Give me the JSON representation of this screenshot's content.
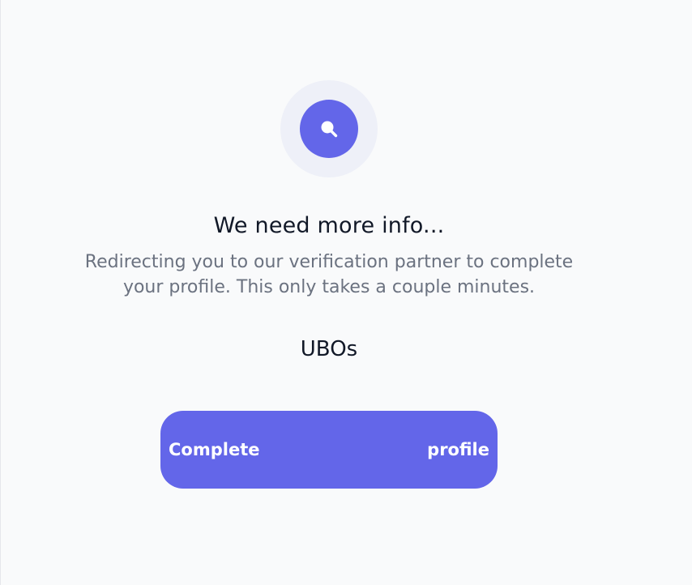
{
  "header": {
    "icon": "search-icon",
    "title": "We need more info..."
  },
  "message": {
    "line1": "Redirecting you to our verification partner to complete",
    "line2": "your profile. This only takes a couple minutes."
  },
  "section": {
    "label": "UBOs"
  },
  "actions": {
    "complete_word_1": "Complete",
    "complete_word_2": "profile"
  },
  "colors": {
    "accent": "#6366e9",
    "icon_ring": "#eef0f8",
    "background": "#f9fafb",
    "title_text": "#111827",
    "muted_text": "#6b7280"
  }
}
